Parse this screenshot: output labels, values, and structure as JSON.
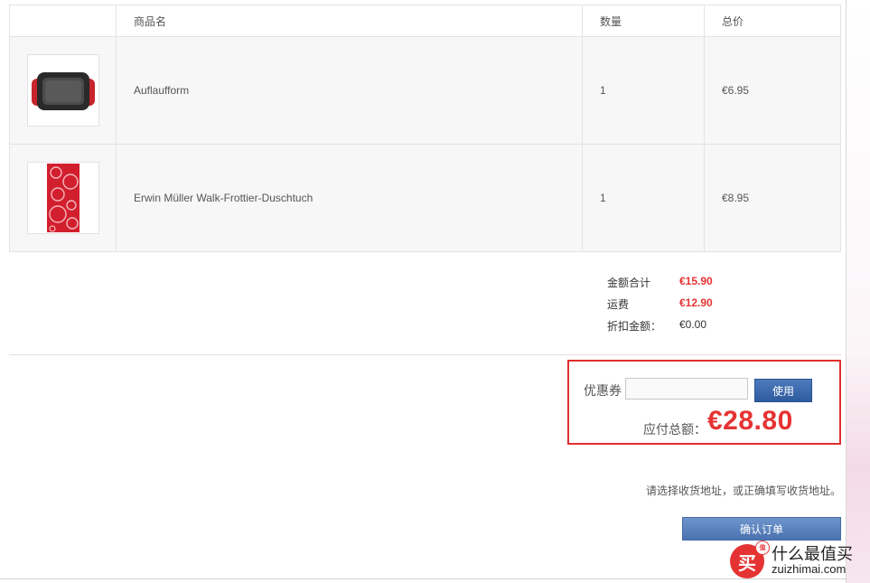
{
  "table": {
    "headers": {
      "name": "商品名",
      "qty": "数量",
      "total": "总价"
    },
    "rows": [
      {
        "image": "baking-dish-image",
        "name": "Auflaufform",
        "qty": "1",
        "total": "€6.95"
      },
      {
        "image": "towel-image",
        "name": "Erwin Müller Walk-Frottier-Duschtuch",
        "qty": "1",
        "total": "€8.95"
      }
    ]
  },
  "summary": {
    "subtotal_label": "金额合计",
    "subtotal_value": "€15.90",
    "shipping_label": "运费",
    "shipping_value": "€12.90",
    "discount_label": "折扣金额：",
    "discount_value": "€0.00"
  },
  "coupon": {
    "label": "优惠券",
    "input_value": "",
    "placeholder": "",
    "button": "使用"
  },
  "payable": {
    "label": "应付总额：",
    "amount": "€28.80"
  },
  "address_hint": "请选择收货地址，或正确填写收货地址。",
  "confirm_button": "确认订单",
  "watermark": {
    "logo_char": "买",
    "badge": "值",
    "title": "什么最值买",
    "url": "zuizhimai.com"
  },
  "colors": {
    "accent_red": "#e53333",
    "button_blue": "#2e5b9e",
    "highlight_border": "#e02f2f"
  }
}
